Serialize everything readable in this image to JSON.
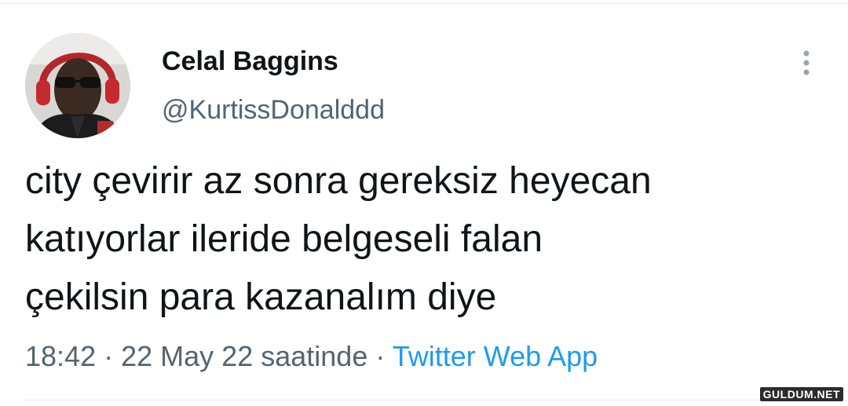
{
  "tweet": {
    "author_name": "Celal Baggins",
    "author_handle": "@KurtissDonalddd",
    "text": "city çevirir az sonra gereksiz heyecan\nkatıyorlar ileride belgeseli falan\nçekilsin para kazanalım diye",
    "time": "18:42",
    "separator": "·",
    "date_text": "22 May 22 saatinde",
    "source": "Twitter Web App",
    "icons": {
      "more": "more-vertical-icon",
      "avatar": "profile-avatar"
    },
    "colors": {
      "text": "#0f1419",
      "secondary": "#536471",
      "link": "#1d9bf0"
    }
  },
  "watermark": {
    "text": "GULDUM.NET"
  }
}
